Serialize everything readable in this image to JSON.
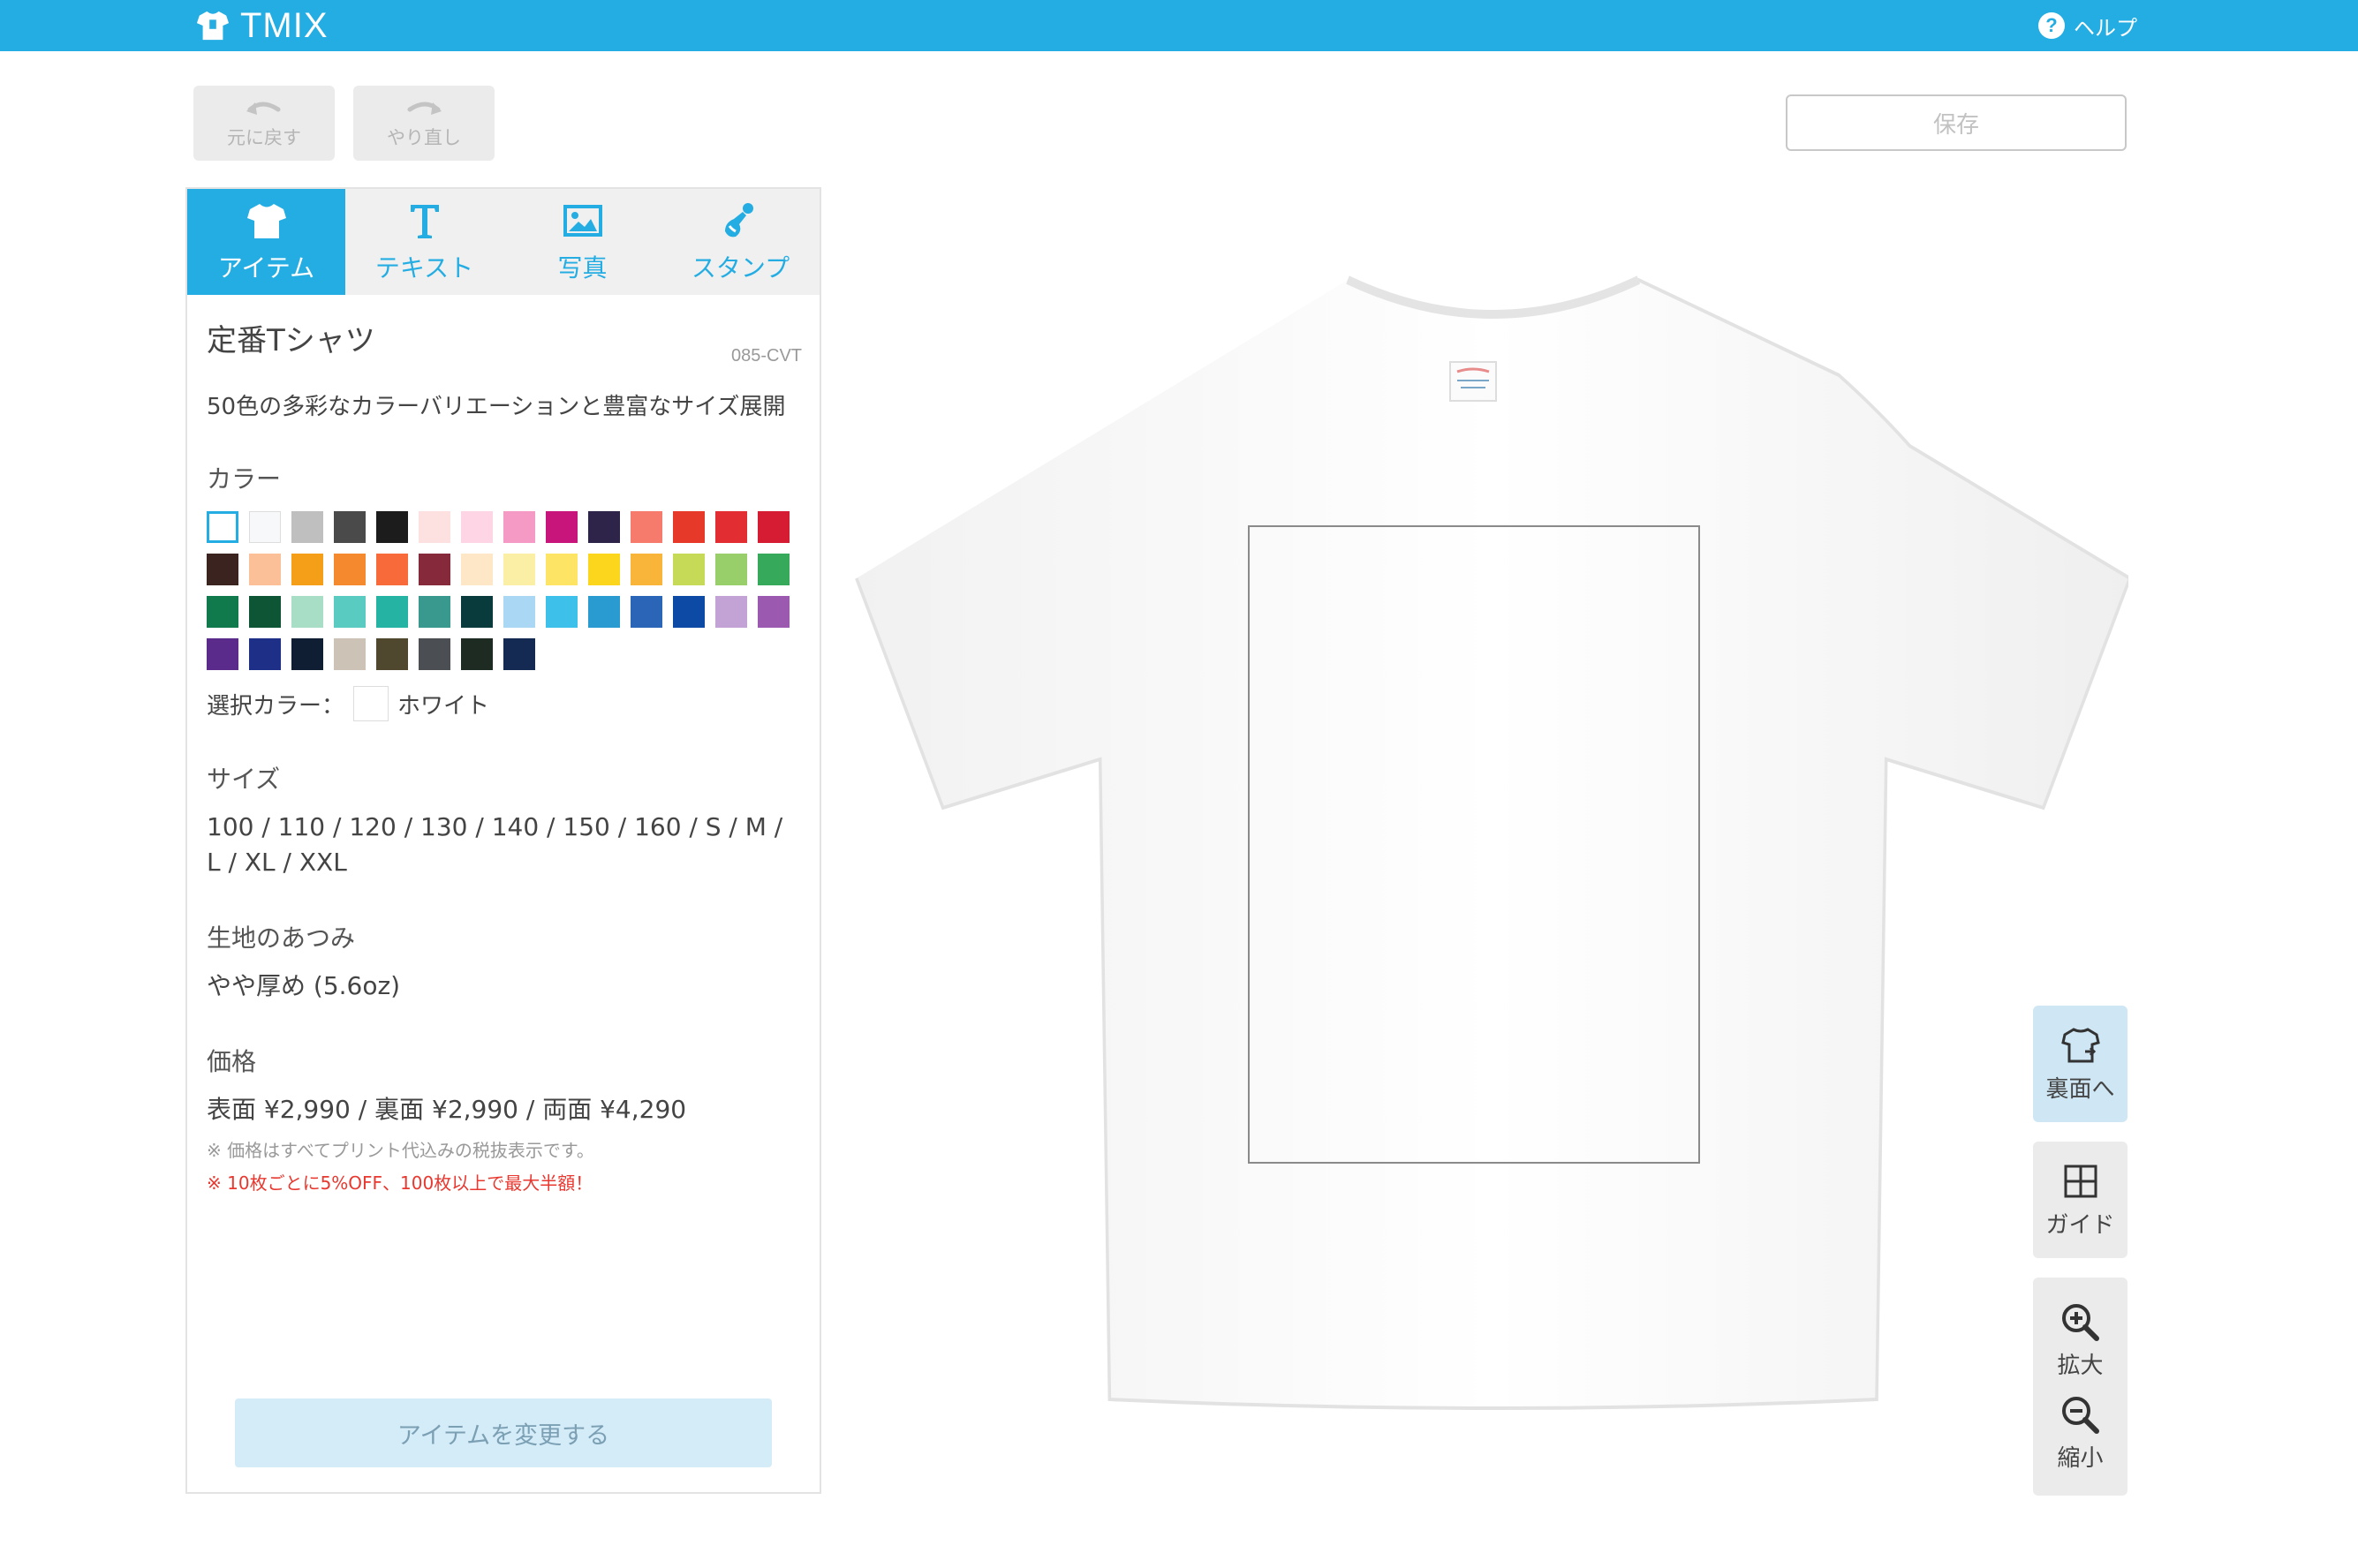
{
  "header": {
    "app_name": "TMIX",
    "help_label": "ヘルプ",
    "help_glyph": "?"
  },
  "history": {
    "undo_label": "元に戻す",
    "redo_label": "やり直し"
  },
  "save_label": "保存",
  "tabs": [
    {
      "label": "アイテム",
      "icon": "tshirt-icon",
      "active": true
    },
    {
      "label": "テキスト",
      "icon": "text-icon",
      "active": false
    },
    {
      "label": "写真",
      "icon": "photo-icon",
      "active": false
    },
    {
      "label": "スタンプ",
      "icon": "stamp-icon",
      "active": false
    }
  ],
  "item": {
    "name": "定番Tシャツ",
    "code": "085-CVT",
    "description": "50色の多彩なカラーバリエーションと豊富なサイズ展開"
  },
  "color": {
    "label": "カラー",
    "selected_label": "選択カラー：",
    "selected_name": "ホワイト",
    "selected_hex": "#ffffff",
    "swatches": [
      "#ffffff",
      "#f6f8f9",
      "#bfbfbf",
      "#4a4a4a",
      "#1c1c1c",
      "#fde1e1",
      "#fdd5e5",
      "#f59ac5",
      "#c8157c",
      "#2e2348",
      "#f77b6c",
      "#e6392a",
      "#e22d33",
      "#d61c33",
      "#3b2320",
      "#fcc099",
      "#f59e17",
      "#f5892d",
      "#f86a3a",
      "#86293a",
      "#fde7c6",
      "#faefa5",
      "#fde465",
      "#fbd61c",
      "#f9b43a",
      "#c7da57",
      "#98cf6b",
      "#37a95a",
      "#117a4d",
      "#0d5535",
      "#a9dec6",
      "#59cbc0",
      "#25b4a3",
      "#39998f",
      "#093b3d",
      "#a9d7f4",
      "#3dc1ea",
      "#2a9bd1",
      "#2b65b7",
      "#0d4aa5",
      "#c3a2d5",
      "#9b5ab0",
      "#5a2b8a",
      "#1d2f86",
      "#0f1e33",
      "#ccc3b6",
      "#50482e",
      "#4b4f54",
      "#1d2b22",
      "#142a52"
    ]
  },
  "size": {
    "label": "サイズ",
    "value": "100 / 110 / 120 / 130 / 140 / 150 / 160 / S / M / L / XL / XXL"
  },
  "thickness": {
    "label": "生地のあつみ",
    "value": "やや厚め (5.6oz)"
  },
  "price": {
    "label": "価格",
    "value": "表面 ¥2,990 / 裏面 ¥2,990 / 両面 ¥4,290",
    "note": "※ 価格はすべてプリント代込みの税抜表示です。",
    "note_discount": "※ 10枚ごとに5%OFF、100枚以上で最大半額！"
  },
  "change_item_label": "アイテムを変更する",
  "tools": {
    "back_label": "裏面へ",
    "guide_label": "ガイド",
    "zoom_in_label": "拡大",
    "zoom_out_label": "縮小"
  }
}
